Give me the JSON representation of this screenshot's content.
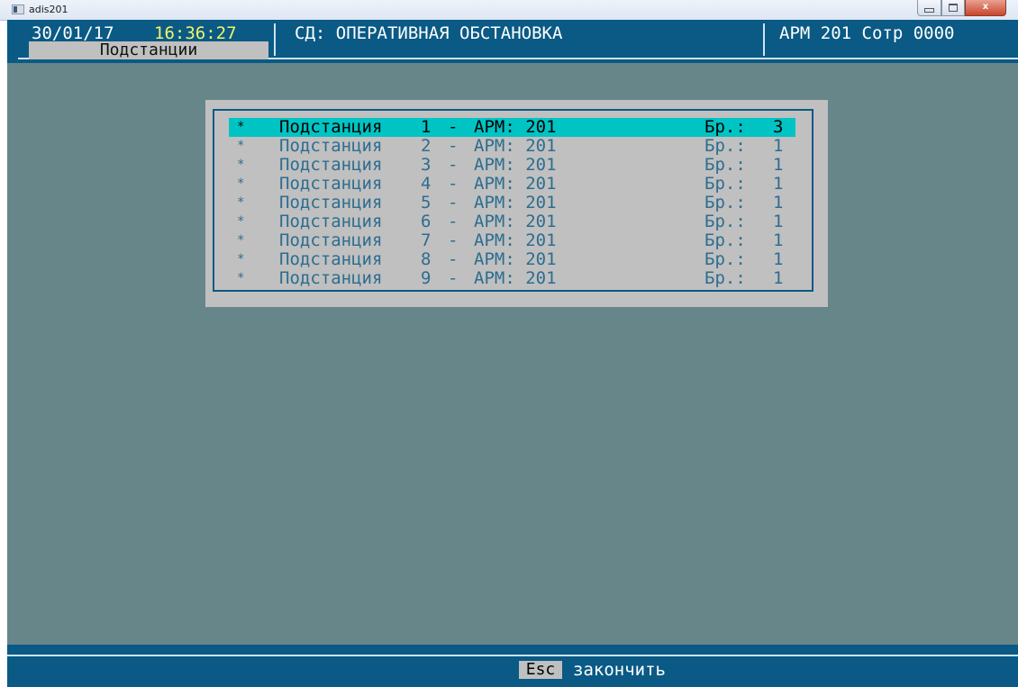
{
  "window": {
    "title": "adis201",
    "buttons": {
      "minimize": "minimize",
      "maximize": "maximize",
      "close": "x"
    }
  },
  "header": {
    "date": "30/01/17",
    "time": "16:36:27",
    "caption": "СД: ОПЕРАТИВНАЯ ОБСТАНОВКА",
    "workstation": "АРМ 201 Сотр 0000",
    "tab_label": "Подстанции",
    "time_color": "#f2f26a"
  },
  "menu": {
    "selected_index": 0,
    "items": [
      {
        "marker": "*",
        "name": "Подстанция",
        "number": "1",
        "dash": "-",
        "arm": "АРМ: 201",
        "br_label": "Бр.:",
        "br_count": "3"
      },
      {
        "marker": "*",
        "name": "Подстанция",
        "number": "2",
        "dash": "-",
        "arm": "АРМ: 201",
        "br_label": "Бр.:",
        "br_count": "1"
      },
      {
        "marker": "*",
        "name": "Подстанция",
        "number": "3",
        "dash": "-",
        "arm": "АРМ: 201",
        "br_label": "Бр.:",
        "br_count": "1"
      },
      {
        "marker": "*",
        "name": "Подстанция",
        "number": "4",
        "dash": "-",
        "arm": "АРМ: 201",
        "br_label": "Бр.:",
        "br_count": "1"
      },
      {
        "marker": "*",
        "name": "Подстанция",
        "number": "5",
        "dash": "-",
        "arm": "АРМ: 201",
        "br_label": "Бр.:",
        "br_count": "1"
      },
      {
        "marker": "*",
        "name": "Подстанция",
        "number": "6",
        "dash": "-",
        "arm": "АРМ: 201",
        "br_label": "Бр.:",
        "br_count": "1"
      },
      {
        "marker": "*",
        "name": "Подстанция",
        "number": "7",
        "dash": "-",
        "arm": "АРМ: 201",
        "br_label": "Бр.:",
        "br_count": "1"
      },
      {
        "marker": "*",
        "name": "Подстанция",
        "number": "8",
        "dash": "-",
        "arm": "АРМ: 201",
        "br_label": "Бр.:",
        "br_count": "1"
      },
      {
        "marker": "*",
        "name": "Подстанция",
        "number": "9",
        "dash": "-",
        "arm": "АРМ: 201",
        "br_label": "Бр.:",
        "br_count": "1"
      }
    ]
  },
  "footer": {
    "key": "Esc",
    "action": "закончить"
  },
  "colors": {
    "background": "#66868a",
    "bar": "#0a5a85",
    "panel": "#c0c0c0",
    "highlight": "#00c4c4",
    "item_text": "#2d6d90"
  }
}
